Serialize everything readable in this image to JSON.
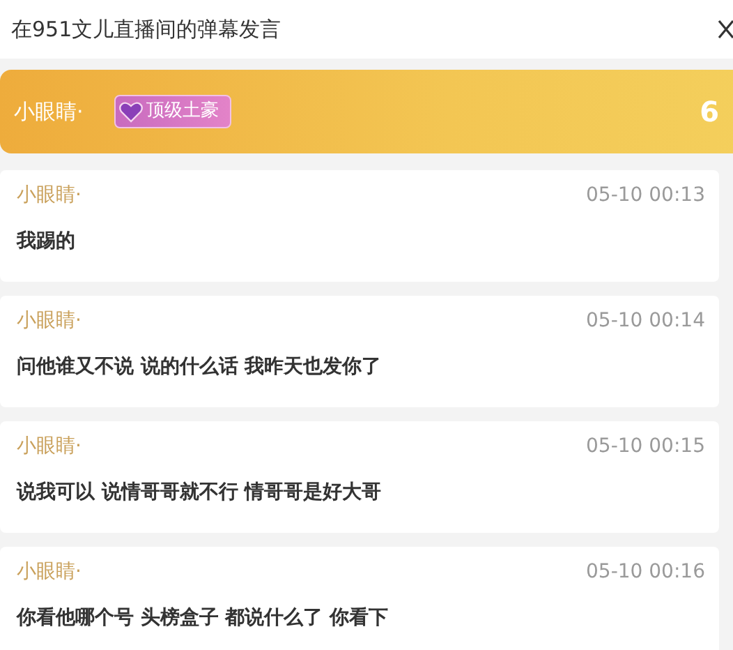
{
  "window": {
    "title": "在951文儿直播间的弹幕发言"
  },
  "user_bar": {
    "name": "小眼睛·",
    "badge": "顶级土豪",
    "count": "6"
  },
  "messages": [
    {
      "name": "小眼睛·",
      "time": "05-10 00:13",
      "text": "我踢的"
    },
    {
      "name": "小眼睛·",
      "time": "05-10 00:14",
      "text": "问他谁又不说 说的什么话 我昨天也发你了"
    },
    {
      "name": "小眼睛·",
      "time": "05-10 00:15",
      "text": "说我可以 说情哥哥就不行 情哥哥是好大哥"
    },
    {
      "name": "小眼睛·",
      "time": "05-10 00:16",
      "text": "你看他哪个号 头榜盒子 都说什么了 你看下"
    }
  ]
}
